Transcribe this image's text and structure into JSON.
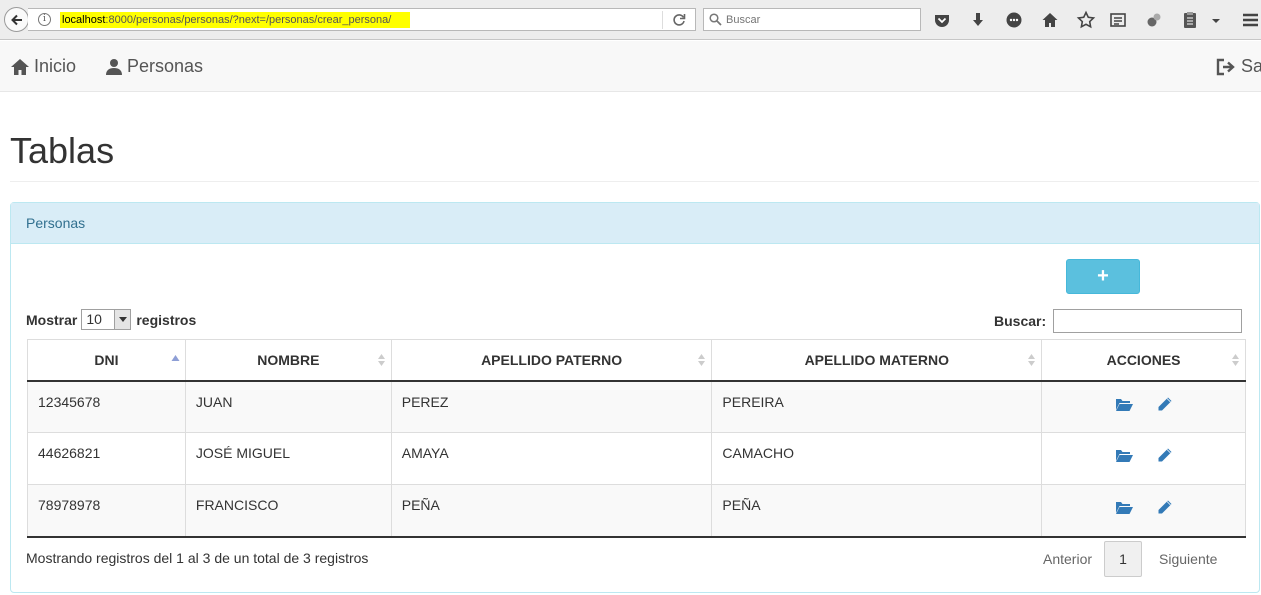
{
  "browser": {
    "url_host": "localhost",
    "url_path": ":8000/personas/personas/?next=/personas/crear_persona/",
    "search_placeholder": "Buscar"
  },
  "navbar": {
    "home_label": "Inicio",
    "personas_label": "Personas",
    "logout_label": "Sa"
  },
  "page": {
    "title": "Tablas"
  },
  "panel": {
    "heading": "Personas",
    "add_label": "+",
    "length_prefix": "Mostrar",
    "length_value": "10",
    "length_suffix": "registros",
    "search_label": "Buscar:",
    "columns": [
      "DNI",
      "NOMBRE",
      "APELLIDO PATERNO",
      "APELLIDO MATERNO",
      "ACCIONES"
    ],
    "rows": [
      [
        "12345678",
        "JUAN",
        "PEREZ",
        "PEREIRA"
      ],
      [
        "44626821",
        "JOSÉ MIGUEL",
        "AMAYA",
        "CAMACHO"
      ],
      [
        "78978978",
        "FRANCISCO",
        "PEÑA",
        "PEÑA"
      ]
    ],
    "info": "Mostrando registros del 1 al 3 de un total de 3 registros",
    "pager": {
      "previous": "Anterior",
      "current_page": "1",
      "next": "Siguiente"
    }
  },
  "colors": {
    "panel_heading_bg": "#d9edf7",
    "panel_border": "#bce8f1",
    "add_button": "#5bc0de",
    "action_icon": "#337ab7",
    "url_highlight": "#ffff00"
  }
}
